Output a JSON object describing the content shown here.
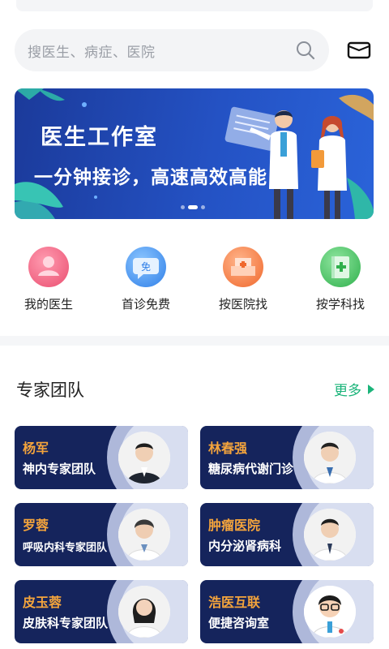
{
  "search": {
    "placeholder": "搜医生、病症、医院"
  },
  "banner": {
    "title": "医生工作室",
    "subtitle": "一分钟接诊，高速高效高能",
    "dots": 3,
    "active_dot": 1
  },
  "quick_entries": [
    {
      "label": "我的医生",
      "icon": "doctor-avatar-icon",
      "color": "#ef5b7b"
    },
    {
      "label": "首诊免费",
      "icon": "free-chat-icon",
      "color": "#3f8ef0"
    },
    {
      "label": "按医院找",
      "icon": "hospital-building-icon",
      "color": "#f57a3c"
    },
    {
      "label": "按学科找",
      "icon": "medical-book-icon",
      "color": "#3fbf5e"
    }
  ],
  "expert_section": {
    "title": "专家团队",
    "more_label": "更多"
  },
  "teams": [
    {
      "name": "杨军",
      "desc": "神内专家团队"
    },
    {
      "name": "林春强",
      "desc": "糖尿病代谢门诊"
    },
    {
      "name": "罗蓉",
      "desc": "呼吸内科专家团队"
    },
    {
      "name": "肿瘤医院",
      "desc": "内分泌肾病科"
    },
    {
      "name": "皮玉蓉",
      "desc": "皮肤科专家团队"
    },
    {
      "name": "浩医互联",
      "desc": "便捷咨询室"
    }
  ],
  "colors": {
    "accent_green": "#1bb47a",
    "card_bg": "#15245c",
    "card_name": "#f4a43c",
    "banner_blue": "#2452c4"
  }
}
